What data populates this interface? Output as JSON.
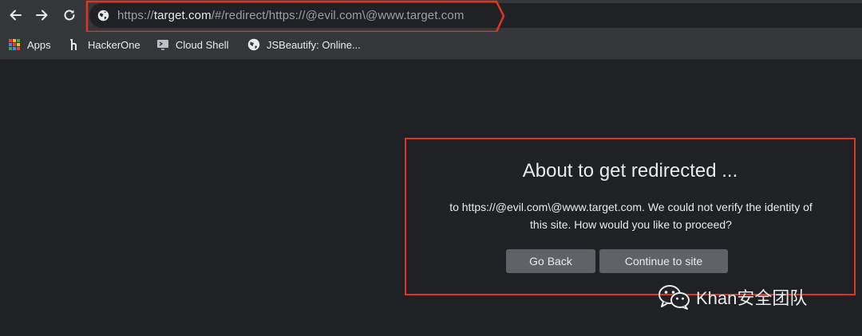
{
  "toolbar": {
    "back_icon": "back-arrow-icon",
    "forward_icon": "forward-arrow-icon",
    "reload_icon": "reload-icon"
  },
  "omnibox": {
    "url_scheme": "https://",
    "url_host": "target.com",
    "url_path": "/#/redirect/https://@evil.com\\@www.target.com",
    "icon": "globe-icon",
    "highlight_color": "#e3341d"
  },
  "bookmarks": [
    {
      "label": "Apps",
      "icon": "apps-grid-icon"
    },
    {
      "label": "HackerOne",
      "icon": "hackerone-icon"
    },
    {
      "label": "Cloud Shell",
      "icon": "cloud-shell-icon"
    },
    {
      "label": "JSBeautify: Online...",
      "icon": "globe-icon"
    }
  ],
  "dialog": {
    "title": "About to get redirected ...",
    "body_line1": "to https://@evil.com\\@www.target.com. We could not verify the identity of",
    "body_line2": "this site. How would you like to proceed?",
    "go_back_label": "Go Back",
    "continue_label": "Continue to site",
    "border_color": "#e3341d"
  },
  "watermark": {
    "text": "Khan安全团队",
    "icon": "wechat-icon"
  }
}
